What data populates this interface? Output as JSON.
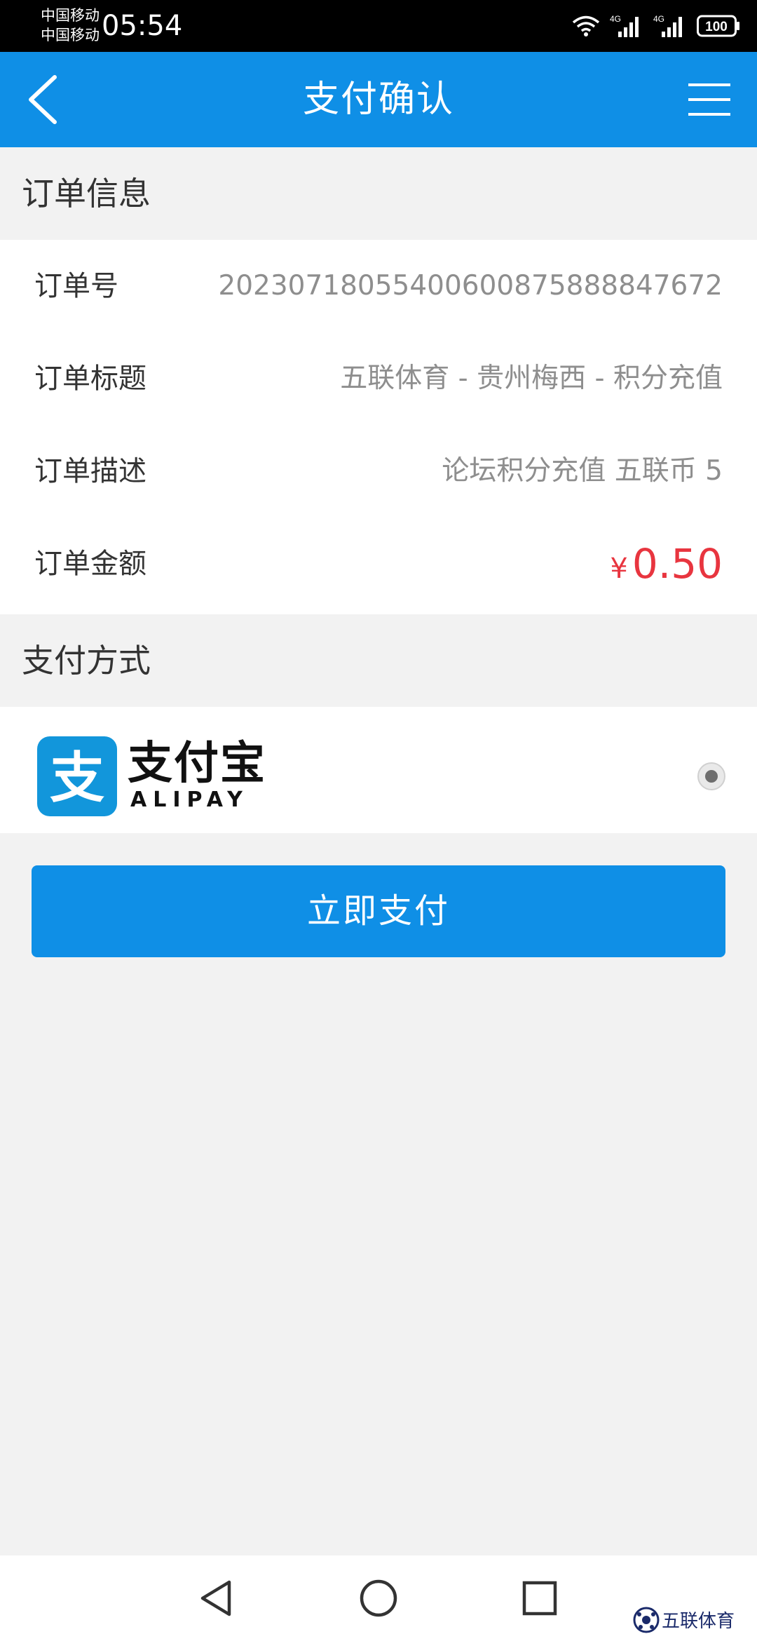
{
  "status_bar": {
    "carrier_1": "中国移动",
    "carrier_2": "中国移动",
    "time": "05:54",
    "signal_1_label": "4G",
    "signal_2_label": "4G",
    "battery": "100"
  },
  "titlebar": {
    "title": "支付确认",
    "back_icon": "chevron-left-icon",
    "menu_icon": "hamburger-menu-icon"
  },
  "order_section": {
    "heading": "订单信息",
    "rows": [
      {
        "label": "订单号",
        "value": "20230718055400600875888847672"
      },
      {
        "label": "订单标题",
        "value": "五联体育 - 贵州梅西 - 积分充值"
      },
      {
        "label": "订单描述",
        "value": "论坛积分充值 五联币 5"
      },
      {
        "label": "订单金额",
        "currency": "¥",
        "value": "0.50"
      }
    ]
  },
  "payment_section": {
    "heading": "支付方式",
    "method_name": "支付宝",
    "method_sub": "ALIPAY",
    "logo_glyph": "支",
    "selected": true
  },
  "pay_button": {
    "label": "立即支付"
  },
  "navbar": {
    "back_icon": "triangle-back-icon",
    "home_icon": "circle-home-icon",
    "recents_icon": "square-recents-icon"
  },
  "watermark": {
    "text": "五联体育"
  },
  "colors": {
    "primary": "#0f8fe6",
    "amount": "#e8353f",
    "alipay": "#1296db",
    "background": "#f2f2f2"
  }
}
